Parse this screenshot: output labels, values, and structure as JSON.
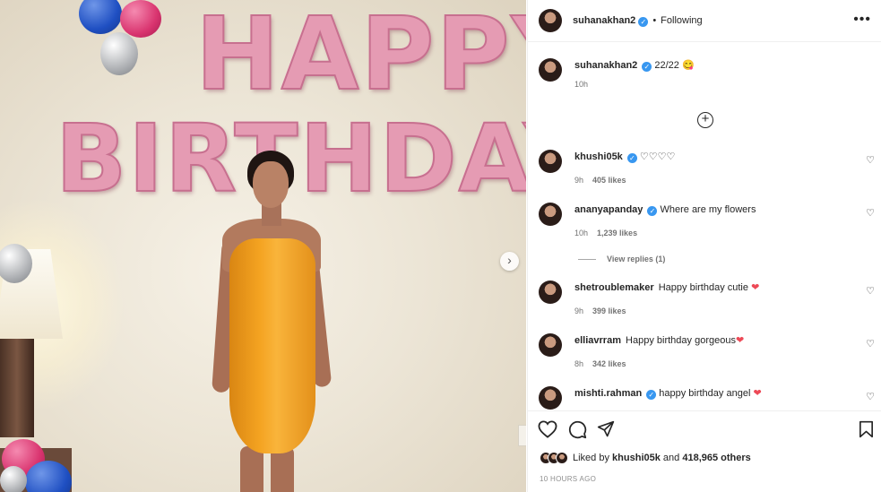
{
  "photo": {
    "balloon_text_top": "HAPPY",
    "balloon_text_bottom": "BIRTHDAY",
    "next_button": "›"
  },
  "header": {
    "username": "suhanakhan2",
    "verified_glyph": "✓",
    "separator": "•",
    "follow_status": "Following",
    "more_icon": "•••"
  },
  "caption": {
    "username": "suhanakhan2",
    "text": "22/22 😋",
    "time": "10h"
  },
  "load_more_icon": "+",
  "comments": [
    {
      "username": "khushi05k",
      "verified": true,
      "text": "♡♡♡♡",
      "time": "9h",
      "likes": "405 likes"
    },
    {
      "username": "ananyapanday",
      "verified": true,
      "text": "Where are my flowers",
      "time": "10h",
      "likes": "1,239 likes"
    },
    {
      "username": "shetroublemaker",
      "verified": false,
      "text": "Happy birthday cutie",
      "emoji": "❤",
      "time": "9h",
      "likes": "399 likes"
    },
    {
      "username": "elliavrram",
      "verified": false,
      "text": "Happy birthday gorgeous",
      "emoji": "❤",
      "time": "8h",
      "likes": "342 likes"
    },
    {
      "username": "mishti.rahman",
      "verified": true,
      "text": "happy birthday angel",
      "emoji": "❤",
      "time": "",
      "likes": ""
    }
  ],
  "view_replies": "View replies (1)",
  "heart_icon": "♡",
  "actions": {
    "like_icon": "heart-outline",
    "comment_icon": "speech-bubble",
    "share_icon": "paper-plane",
    "save_icon": "bookmark"
  },
  "liked_by": {
    "prefix": "Liked by",
    "user": "khushi05k",
    "middle": "and",
    "others": "418,965 others"
  },
  "timestamp": "10 HOURS AGO",
  "colors": {
    "verified_blue": "#3897f0",
    "heart_red": "#ed4956",
    "dress_orange": "#f4a321",
    "foil_pink": "#e59bb3"
  }
}
